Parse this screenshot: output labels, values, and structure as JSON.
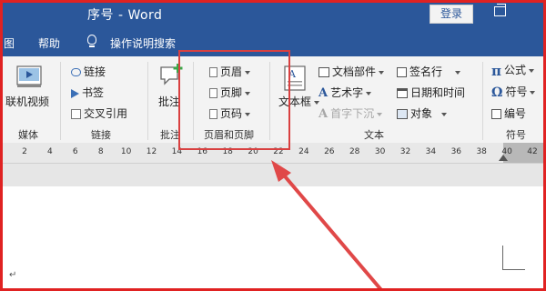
{
  "titlebar": {
    "title": "序号 - Word",
    "login": "登录"
  },
  "tabs": {
    "help_prefix": "图",
    "help": "帮助",
    "tell_me": "操作说明搜索"
  },
  "ribbon": {
    "media": {
      "video": "联机视频",
      "label": "媒体"
    },
    "links": {
      "link": "链接",
      "bookmark": "书签",
      "cross_ref": "交叉引用",
      "label": "链接"
    },
    "comments": {
      "comment": "批注",
      "label": "批注"
    },
    "header_footer": {
      "header": "页眉",
      "footer": "页脚",
      "page_number": "页码",
      "label": "页眉和页脚"
    },
    "text": {
      "textbox": "文本框",
      "quick_parts": "文档部件",
      "wordart": "艺术字",
      "dropcap": "首字下沉",
      "signature": "签名行",
      "datetime": "日期和时间",
      "object": "对象",
      "label": "文本"
    },
    "symbols": {
      "equation": "公式",
      "symbol": "符号",
      "numbering": "编号",
      "label": "符号"
    }
  },
  "ruler": {
    "ticks": [
      "2",
      "4",
      "6",
      "8",
      "10",
      "12",
      "14",
      "16",
      "18",
      "20",
      "22",
      "24",
      "26",
      "28",
      "30",
      "32",
      "34",
      "36",
      "38",
      "40",
      "42"
    ]
  },
  "document": {
    "para_mark": "↵"
  },
  "colors": {
    "accent": "#2b579a",
    "highlight": "#d94040",
    "frame": "#e02222"
  }
}
